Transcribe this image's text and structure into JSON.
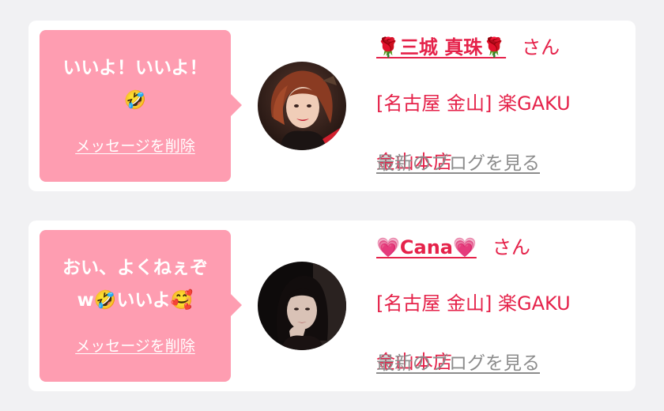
{
  "messages": [
    {
      "text": "いいよ！いいよ！\n🤣",
      "delete_label": "メッセージを削除",
      "cast_name": "🌹三城 真珠🌹",
      "honorific": "さん",
      "shop_line1": "[名古屋 金山] 楽GAKU",
      "shop_line2": "金山本店",
      "blog_label": "最新のブログを見る",
      "avatar": "photo-woman-red-hair"
    },
    {
      "text": "おい、よくねぇぞ\nw🤣いいよ🥰",
      "delete_label": "メッセージを削除",
      "cast_name": "💗Cana💗",
      "honorific": "さん",
      "shop_line1": "[名古屋 金山] 楽GAKU",
      "shop_line2": "金山本店",
      "blog_label": "最新のブログを見る",
      "avatar": "photo-woman-dark-hair"
    }
  ],
  "colors": {
    "background": "#f1f1f3",
    "card": "#ffffff",
    "bubble": "#fe9db1",
    "accent": "#e5224a",
    "muted": "#8c8c8c"
  }
}
